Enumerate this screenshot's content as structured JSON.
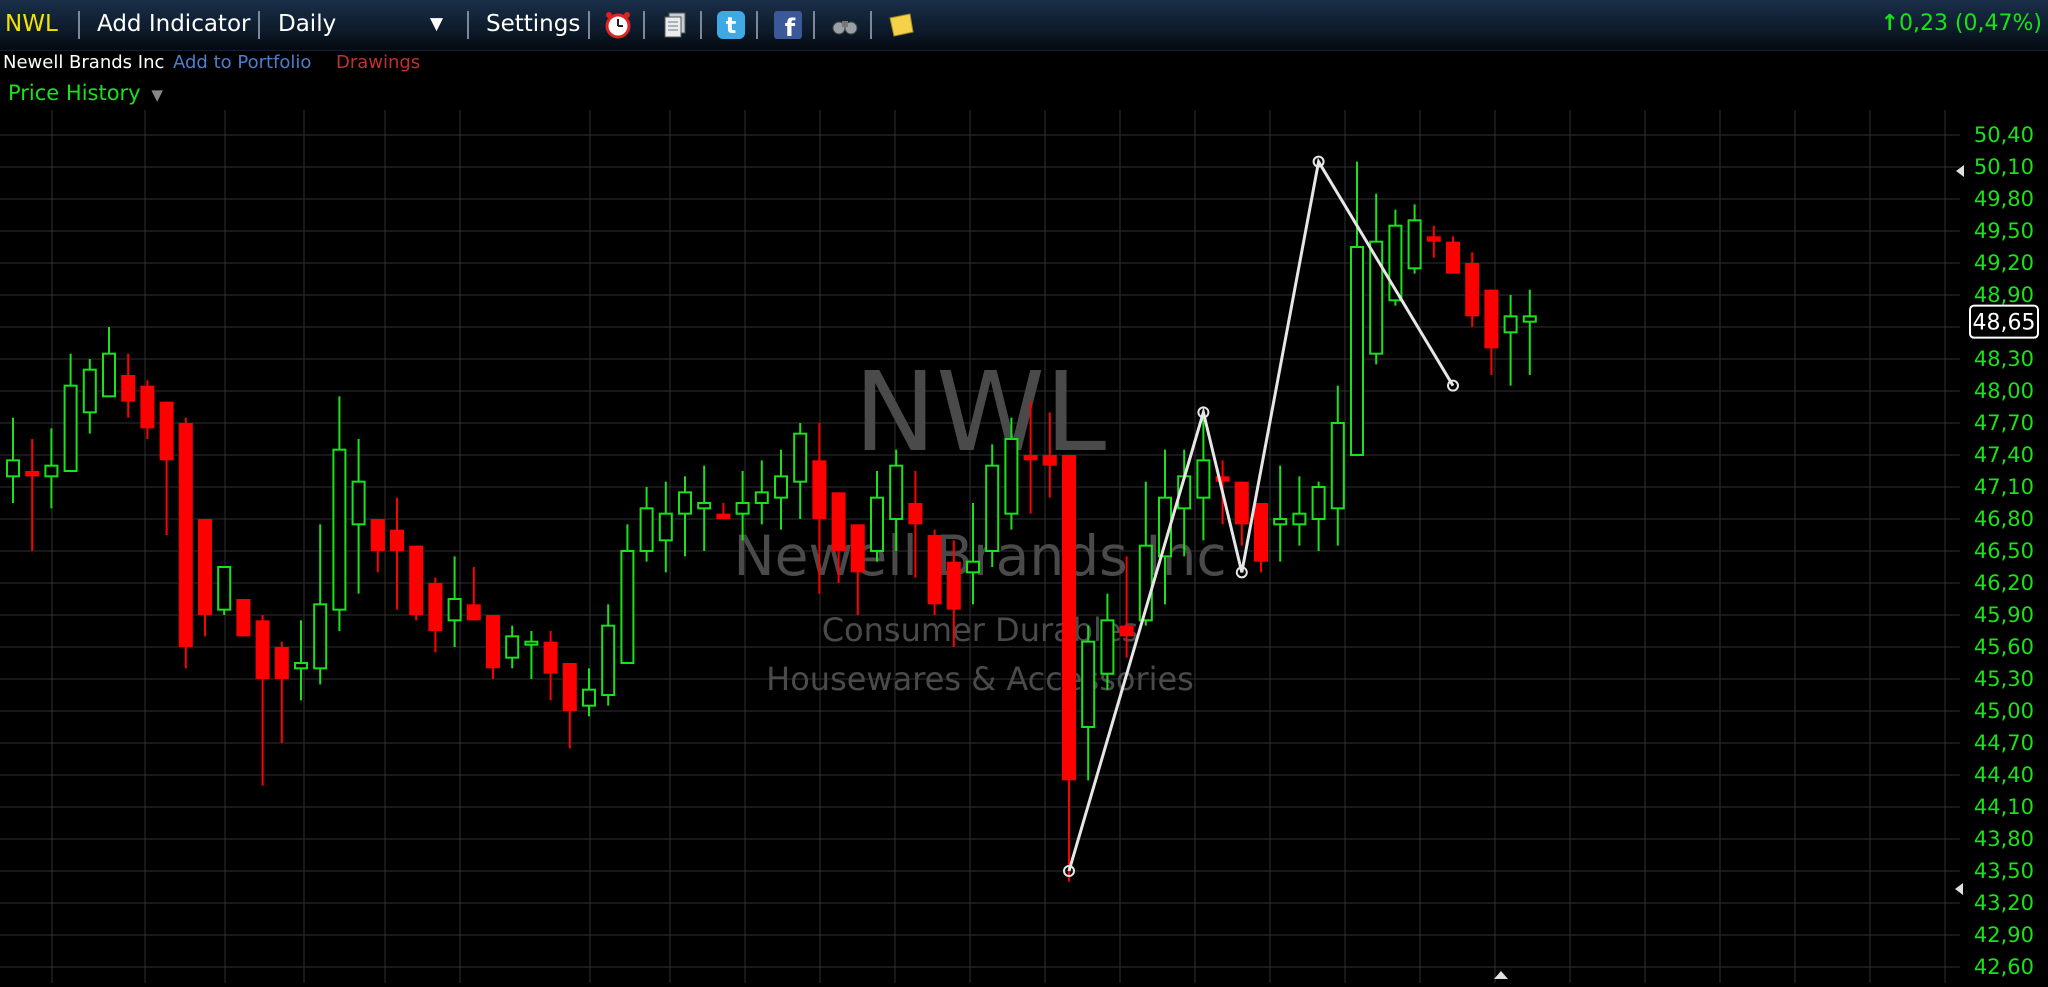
{
  "toolbar": {
    "symbol": "NWL",
    "add_indicator": "Add Indicator",
    "interval": "Daily",
    "settings": "Settings",
    "change": "0,23 (0,47%)",
    "icons": [
      "alarm-clock-icon",
      "document-stack-icon",
      "twitter-icon",
      "facebook-icon",
      "binoculars-icon",
      "sticky-note-icon"
    ]
  },
  "subheader": {
    "company": "Newell Brands Inc",
    "add_to_portfolio": "Add to Portfolio",
    "drawings": "Drawings"
  },
  "panel": {
    "title": "Price History"
  },
  "watermark": {
    "symbol": "NWL",
    "company": "Newell Brands Inc",
    "sector": "Consumer Durables",
    "industry": "Housewares & Accessories"
  },
  "colors": {
    "up": "#19e219",
    "down": "#ff0000",
    "grid": "#303030",
    "axis_text": "#19e219",
    "toolbar_symbol": "#f2e300",
    "link": "#4a7fd0",
    "drawings": "#c03030",
    "zigzag": "#e6e6e6"
  },
  "chart_data": {
    "type": "candlestick",
    "ylim": [
      42.6,
      50.4
    ],
    "y_ticks": [
      "50,40",
      "50,10",
      "49,80",
      "49,50",
      "49,20",
      "48,90",
      "48,60",
      "48,30",
      "48,00",
      "47,70",
      "47,40",
      "47,10",
      "46,80",
      "46,50",
      "46,20",
      "45,90",
      "45,60",
      "45,30",
      "45,00",
      "44,70",
      "44,40",
      "44,10",
      "43,80",
      "43,50",
      "43,20",
      "42,90",
      "42,60"
    ],
    "last_price": "48,65",
    "candles": [
      {
        "o": 47.2,
        "h": 47.75,
        "l": 46.95,
        "c": 47.35
      },
      {
        "o": 47.25,
        "h": 47.55,
        "l": 46.5,
        "c": 47.2
      },
      {
        "o": 47.2,
        "h": 47.65,
        "l": 46.9,
        "c": 47.3
      },
      {
        "o": 47.25,
        "h": 48.35,
        "l": 47.25,
        "c": 48.05
      },
      {
        "o": 47.8,
        "h": 48.3,
        "l": 47.6,
        "c": 48.2
      },
      {
        "o": 47.95,
        "h": 48.6,
        "l": 47.95,
        "c": 48.35
      },
      {
        "o": 48.15,
        "h": 48.35,
        "l": 47.75,
        "c": 47.9
      },
      {
        "o": 48.05,
        "h": 48.1,
        "l": 47.55,
        "c": 47.65
      },
      {
        "o": 47.9,
        "h": 47.9,
        "l": 46.65,
        "c": 47.35
      },
      {
        "o": 47.7,
        "h": 47.75,
        "l": 45.4,
        "c": 45.6
      },
      {
        "o": 46.8,
        "h": 46.8,
        "l": 45.7,
        "c": 45.9
      },
      {
        "o": 45.95,
        "h": 46.35,
        "l": 45.9,
        "c": 46.35
      },
      {
        "o": 46.05,
        "h": 46.05,
        "l": 45.7,
        "c": 45.7
      },
      {
        "o": 45.85,
        "h": 45.9,
        "l": 44.3,
        "c": 45.3
      },
      {
        "o": 45.6,
        "h": 45.65,
        "l": 44.7,
        "c": 45.3
      },
      {
        "o": 45.4,
        "h": 45.85,
        "l": 45.1,
        "c": 45.45
      },
      {
        "o": 45.4,
        "h": 46.75,
        "l": 45.25,
        "c": 46.0
      },
      {
        "o": 45.95,
        "h": 47.95,
        "l": 45.75,
        "c": 47.45
      },
      {
        "o": 46.75,
        "h": 47.55,
        "l": 46.1,
        "c": 47.15
      },
      {
        "o": 46.8,
        "h": 46.8,
        "l": 46.3,
        "c": 46.5
      },
      {
        "o": 46.7,
        "h": 47.0,
        "l": 45.95,
        "c": 46.5
      },
      {
        "o": 46.55,
        "h": 46.55,
        "l": 45.85,
        "c": 45.9
      },
      {
        "o": 46.2,
        "h": 46.25,
        "l": 45.55,
        "c": 45.75
      },
      {
        "o": 45.85,
        "h": 46.45,
        "l": 45.6,
        "c": 46.05
      },
      {
        "o": 46.0,
        "h": 46.35,
        "l": 45.85,
        "c": 45.85
      },
      {
        "o": 45.9,
        "h": 45.9,
        "l": 45.3,
        "c": 45.4
      },
      {
        "o": 45.5,
        "h": 45.8,
        "l": 45.4,
        "c": 45.7
      },
      {
        "o": 45.65,
        "h": 45.75,
        "l": 45.3,
        "c": 45.65
      },
      {
        "o": 45.65,
        "h": 45.75,
        "l": 45.1,
        "c": 45.35
      },
      {
        "o": 45.45,
        "h": 45.45,
        "l": 44.65,
        "c": 45.0
      },
      {
        "o": 45.05,
        "h": 45.4,
        "l": 44.95,
        "c": 45.2
      },
      {
        "o": 45.15,
        "h": 46.0,
        "l": 45.05,
        "c": 45.8
      },
      {
        "o": 45.45,
        "h": 46.75,
        "l": 45.45,
        "c": 46.5
      },
      {
        "o": 46.5,
        "h": 47.1,
        "l": 46.4,
        "c": 46.9
      },
      {
        "o": 46.6,
        "h": 47.15,
        "l": 46.3,
        "c": 46.85
      },
      {
        "o": 46.85,
        "h": 47.2,
        "l": 46.45,
        "c": 47.05
      },
      {
        "o": 46.9,
        "h": 47.3,
        "l": 46.5,
        "c": 46.95
      },
      {
        "o": 46.85,
        "h": 46.95,
        "l": 46.8,
        "c": 46.8
      },
      {
        "o": 46.85,
        "h": 47.25,
        "l": 46.6,
        "c": 46.95
      },
      {
        "o": 46.95,
        "h": 47.35,
        "l": 46.75,
        "c": 47.05
      },
      {
        "o": 47.0,
        "h": 47.45,
        "l": 46.7,
        "c": 47.2
      },
      {
        "o": 47.15,
        "h": 47.7,
        "l": 46.8,
        "c": 47.6
      },
      {
        "o": 47.35,
        "h": 47.7,
        "l": 46.1,
        "c": 46.8
      },
      {
        "o": 47.05,
        "h": 47.05,
        "l": 46.2,
        "c": 46.5
      },
      {
        "o": 46.75,
        "h": 46.75,
        "l": 45.9,
        "c": 46.3
      },
      {
        "o": 46.5,
        "h": 47.25,
        "l": 46.4,
        "c": 47.0
      },
      {
        "o": 46.8,
        "h": 47.45,
        "l": 46.5,
        "c": 47.3
      },
      {
        "o": 46.95,
        "h": 47.25,
        "l": 46.25,
        "c": 46.75
      },
      {
        "o": 46.65,
        "h": 46.7,
        "l": 45.9,
        "c": 46.0
      },
      {
        "o": 46.4,
        "h": 46.6,
        "l": 45.6,
        "c": 45.95
      },
      {
        "o": 46.3,
        "h": 46.95,
        "l": 46.0,
        "c": 46.4
      },
      {
        "o": 46.5,
        "h": 47.5,
        "l": 46.35,
        "c": 47.3
      },
      {
        "o": 46.85,
        "h": 47.75,
        "l": 46.7,
        "c": 47.55
      },
      {
        "o": 47.4,
        "h": 47.9,
        "l": 46.85,
        "c": 47.35
      },
      {
        "o": 47.4,
        "h": 47.8,
        "l": 47.0,
        "c": 47.3
      },
      {
        "o": 47.4,
        "h": 47.4,
        "l": 43.4,
        "c": 44.35
      },
      {
        "o": 44.85,
        "h": 45.8,
        "l": 44.35,
        "c": 45.65
      },
      {
        "o": 45.35,
        "h": 46.1,
        "l": 45.2,
        "c": 45.85
      },
      {
        "o": 45.8,
        "h": 46.45,
        "l": 45.5,
        "c": 45.7
      },
      {
        "o": 45.85,
        "h": 47.15,
        "l": 45.8,
        "c": 46.55
      },
      {
        "o": 46.45,
        "h": 47.45,
        "l": 46.0,
        "c": 47.0
      },
      {
        "o": 46.9,
        "h": 47.45,
        "l": 46.45,
        "c": 47.2
      },
      {
        "o": 47.0,
        "h": 47.75,
        "l": 46.6,
        "c": 47.35
      },
      {
        "o": 47.2,
        "h": 47.35,
        "l": 46.75,
        "c": 47.15
      },
      {
        "o": 47.15,
        "h": 47.15,
        "l": 46.55,
        "c": 46.75
      },
      {
        "o": 46.95,
        "h": 46.95,
        "l": 46.3,
        "c": 46.4
      },
      {
        "o": 46.75,
        "h": 47.3,
        "l": 46.4,
        "c": 46.8
      },
      {
        "o": 46.75,
        "h": 47.2,
        "l": 46.55,
        "c": 46.85
      },
      {
        "o": 46.8,
        "h": 47.15,
        "l": 46.5,
        "c": 47.1
      },
      {
        "o": 46.9,
        "h": 48.05,
        "l": 46.55,
        "c": 47.7
      },
      {
        "o": 47.4,
        "h": 50.15,
        "l": 47.4,
        "c": 49.35
      },
      {
        "o": 48.35,
        "h": 49.85,
        "l": 48.25,
        "c": 49.4
      },
      {
        "o": 48.85,
        "h": 49.7,
        "l": 48.8,
        "c": 49.55
      },
      {
        "o": 49.15,
        "h": 49.75,
        "l": 49.1,
        "c": 49.6
      },
      {
        "o": 49.45,
        "h": 49.55,
        "l": 49.25,
        "c": 49.4
      },
      {
        "o": 49.4,
        "h": 49.45,
        "l": 49.1,
        "c": 49.1
      },
      {
        "o": 49.2,
        "h": 49.3,
        "l": 48.6,
        "c": 48.7
      },
      {
        "o": 48.95,
        "h": 48.95,
        "l": 48.15,
        "c": 48.4
      },
      {
        "o": 48.55,
        "h": 48.9,
        "l": 48.05,
        "c": 48.7
      },
      {
        "o": 48.65,
        "h": 48.95,
        "l": 48.15,
        "c": 48.7
      }
    ],
    "zigzag": [
      {
        "i": 55,
        "v": 43.5
      },
      {
        "i": 62,
        "v": 47.8
      },
      {
        "i": 64,
        "v": 46.3
      },
      {
        "i": 68,
        "v": 50.15
      },
      {
        "i": 75,
        "v": 48.05
      }
    ]
  }
}
